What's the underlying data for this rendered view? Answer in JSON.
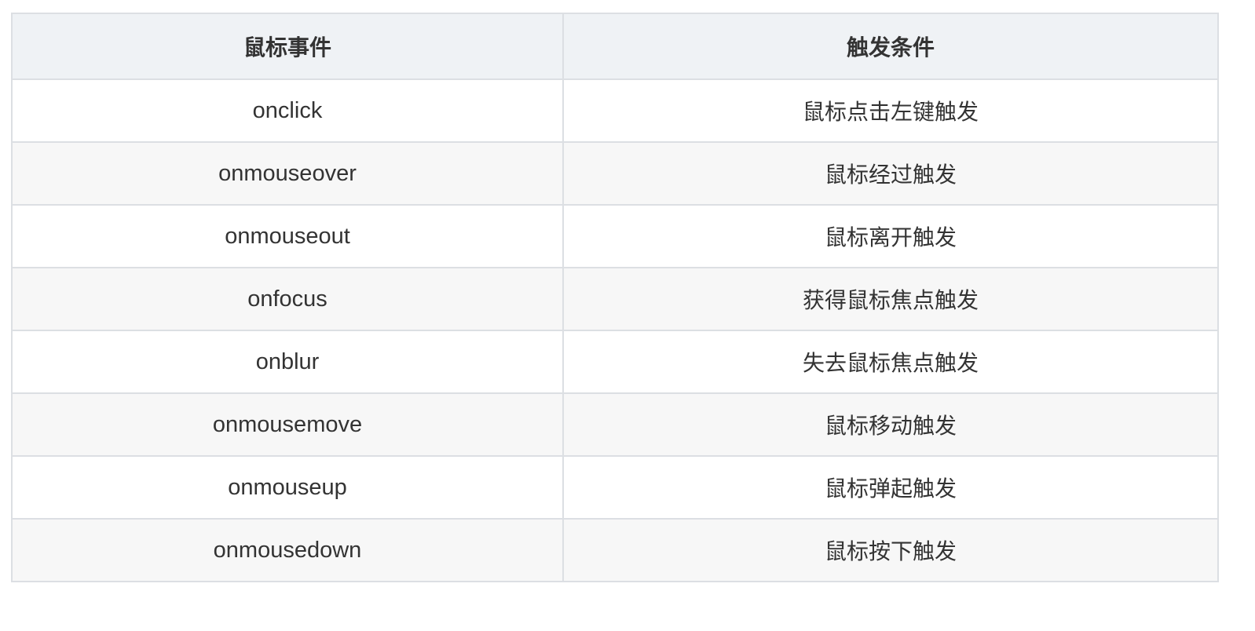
{
  "table": {
    "headers": [
      "鼠标事件",
      "触发条件"
    ],
    "rows": [
      {
        "event": "onclick",
        "condition": "鼠标点击左键触发"
      },
      {
        "event": "onmouseover",
        "condition": "鼠标经过触发"
      },
      {
        "event": "onmouseout",
        "condition": "鼠标离开触发"
      },
      {
        "event": "onfocus",
        "condition": "获得鼠标焦点触发"
      },
      {
        "event": "onblur",
        "condition": "失去鼠标焦点触发"
      },
      {
        "event": "onmousemove",
        "condition": "鼠标移动触发"
      },
      {
        "event": "onmouseup",
        "condition": "鼠标弹起触发"
      },
      {
        "event": "onmousedown",
        "condition": "鼠标按下触发"
      }
    ]
  },
  "colors": {
    "header_bg": "#eff2f5",
    "row_odd_bg": "#ffffff",
    "row_even_bg": "#f7f7f7",
    "border": "#dcdfe3",
    "text": "#333333"
  }
}
